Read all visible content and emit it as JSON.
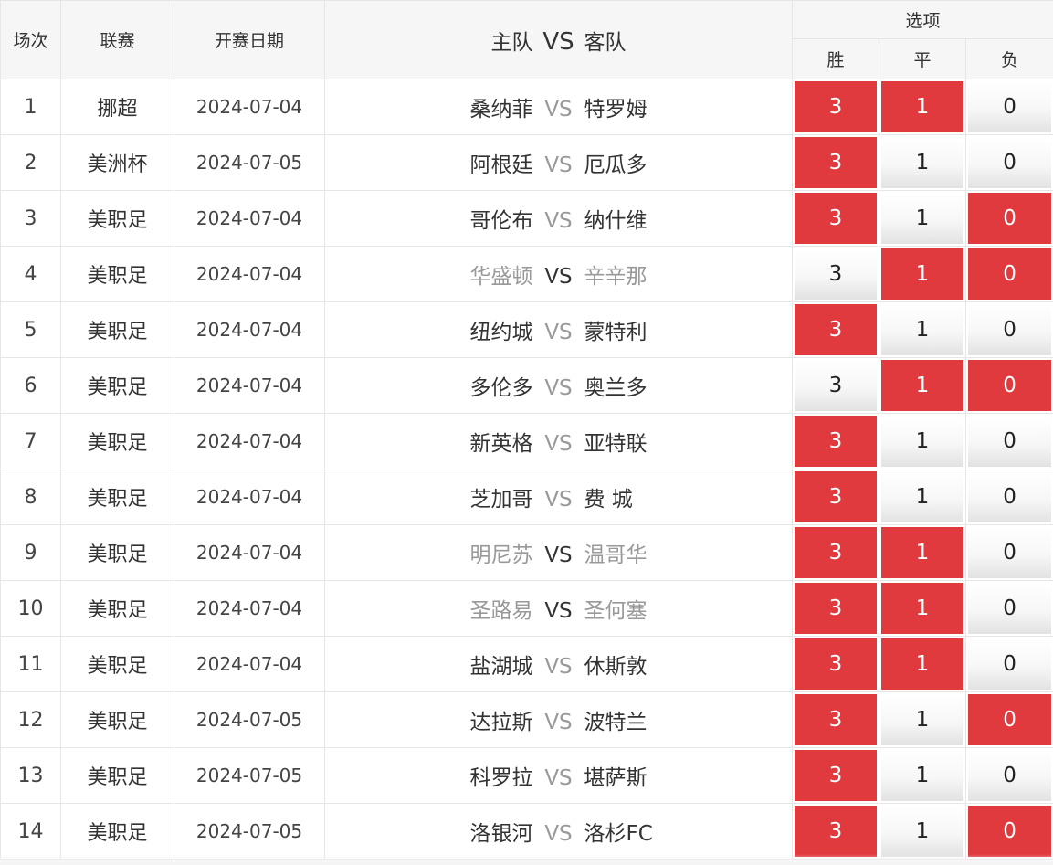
{
  "header": {
    "col_round": "场次",
    "col_league": "联赛",
    "col_date": "开赛日期",
    "col_home": "主队",
    "col_vs": "VS",
    "col_away": "客队",
    "options_label": "选项",
    "opt_win": "胜",
    "opt_draw": "平",
    "opt_lose": "负"
  },
  "colors": {
    "selected": "#e0393e",
    "muted_team": "#999999"
  },
  "rows": [
    {
      "n": "1",
      "league": "挪超",
      "date": "2024-07-04",
      "home": "桑纳菲",
      "vs": "VS",
      "away": "特罗姆",
      "teams_muted": false,
      "w": "3",
      "d": "1",
      "l": "0",
      "sel": [
        true,
        true,
        false
      ]
    },
    {
      "n": "2",
      "league": "美洲杯",
      "date": "2024-07-05",
      "home": "阿根廷",
      "vs": "VS",
      "away": "厄瓜多",
      "teams_muted": false,
      "w": "3",
      "d": "1",
      "l": "0",
      "sel": [
        true,
        false,
        false
      ]
    },
    {
      "n": "3",
      "league": "美职足",
      "date": "2024-07-04",
      "home": "哥伦布",
      "vs": "VS",
      "away": "纳什维",
      "teams_muted": false,
      "w": "3",
      "d": "1",
      "l": "0",
      "sel": [
        true,
        false,
        true
      ]
    },
    {
      "n": "4",
      "league": "美职足",
      "date": "2024-07-04",
      "home": "华盛顿",
      "vs": "VS",
      "away": "辛辛那",
      "teams_muted": true,
      "w": "3",
      "d": "1",
      "l": "0",
      "sel": [
        false,
        true,
        true
      ]
    },
    {
      "n": "5",
      "league": "美职足",
      "date": "2024-07-04",
      "home": "纽约城",
      "vs": "VS",
      "away": "蒙特利",
      "teams_muted": false,
      "w": "3",
      "d": "1",
      "l": "0",
      "sel": [
        true,
        false,
        false
      ]
    },
    {
      "n": "6",
      "league": "美职足",
      "date": "2024-07-04",
      "home": "多伦多",
      "vs": "VS",
      "away": "奥兰多",
      "teams_muted": false,
      "w": "3",
      "d": "1",
      "l": "0",
      "sel": [
        false,
        true,
        true
      ]
    },
    {
      "n": "7",
      "league": "美职足",
      "date": "2024-07-04",
      "home": "新英格",
      "vs": "VS",
      "away": "亚特联",
      "teams_muted": false,
      "w": "3",
      "d": "1",
      "l": "0",
      "sel": [
        true,
        false,
        false
      ]
    },
    {
      "n": "8",
      "league": "美职足",
      "date": "2024-07-04",
      "home": "芝加哥",
      "vs": "VS",
      "away": "费 城",
      "teams_muted": false,
      "w": "3",
      "d": "1",
      "l": "0",
      "sel": [
        true,
        false,
        false
      ]
    },
    {
      "n": "9",
      "league": "美职足",
      "date": "2024-07-04",
      "home": "明尼苏",
      "vs": "VS",
      "away": "温哥华",
      "teams_muted": true,
      "w": "3",
      "d": "1",
      "l": "0",
      "sel": [
        true,
        true,
        false
      ]
    },
    {
      "n": "10",
      "league": "美职足",
      "date": "2024-07-04",
      "home": "圣路易",
      "vs": "VS",
      "away": "圣何塞",
      "teams_muted": true,
      "w": "3",
      "d": "1",
      "l": "0",
      "sel": [
        true,
        true,
        false
      ]
    },
    {
      "n": "11",
      "league": "美职足",
      "date": "2024-07-04",
      "home": "盐湖城",
      "vs": "VS",
      "away": "休斯敦",
      "teams_muted": false,
      "w": "3",
      "d": "1",
      "l": "0",
      "sel": [
        true,
        true,
        false
      ]
    },
    {
      "n": "12",
      "league": "美职足",
      "date": "2024-07-05",
      "home": "达拉斯",
      "vs": "VS",
      "away": "波特兰",
      "teams_muted": false,
      "w": "3",
      "d": "1",
      "l": "0",
      "sel": [
        true,
        false,
        true
      ]
    },
    {
      "n": "13",
      "league": "美职足",
      "date": "2024-07-05",
      "home": "科罗拉",
      "vs": "VS",
      "away": "堪萨斯",
      "teams_muted": false,
      "w": "3",
      "d": "1",
      "l": "0",
      "sel": [
        true,
        false,
        false
      ]
    },
    {
      "n": "14",
      "league": "美职足",
      "date": "2024-07-05",
      "home": "洛银河",
      "vs": "VS",
      "away": "洛杉FC",
      "teams_muted": false,
      "w": "3",
      "d": "1",
      "l": "0",
      "sel": [
        true,
        false,
        true
      ]
    }
  ]
}
